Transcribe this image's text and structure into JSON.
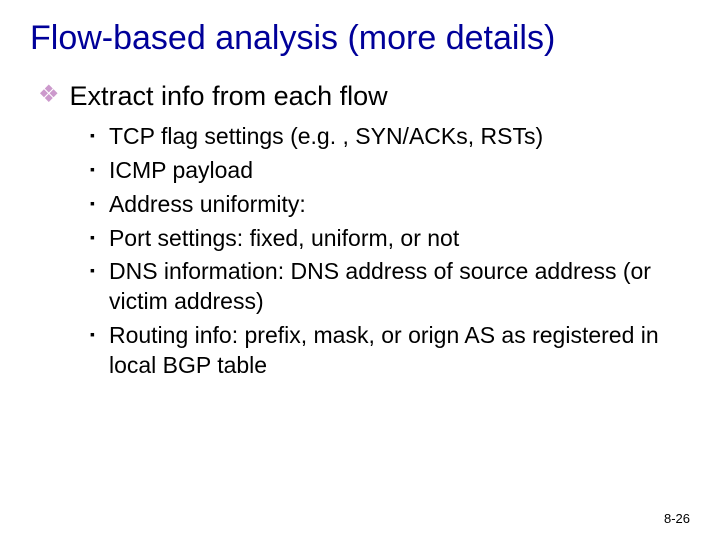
{
  "title": "Flow-based analysis (more details)",
  "level1": {
    "text": "Extract info from each flow"
  },
  "level2": [
    "TCP flag settings (e.g. , SYN/ACKs, RSTs)",
    "ICMP payload",
    "Address uniformity:",
    "Port settings: fixed, uniform, or not",
    "DNS information: DNS address of source address (or victim address)",
    "Routing info: prefix, mask, or orign AS as registered in local BGP table"
  ],
  "pageNumber": "8-26",
  "bullets": {
    "diamond": "❖",
    "square": "▪"
  }
}
